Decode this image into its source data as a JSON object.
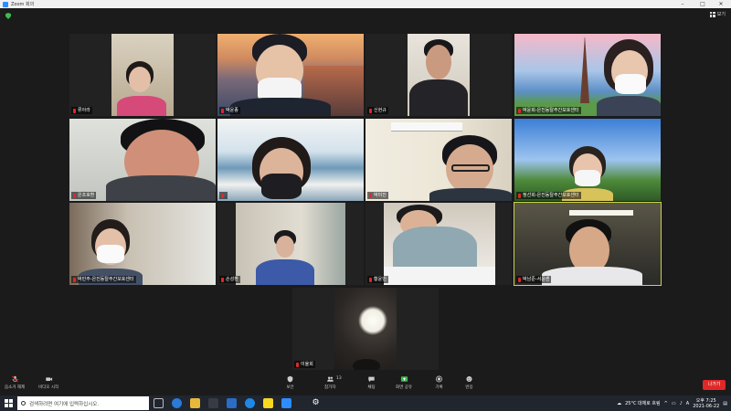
{
  "window": {
    "title": "Zoom 회의",
    "minimize": "–",
    "maximize": "□",
    "close": "✕"
  },
  "header": {
    "view_label": "보기"
  },
  "participants": [
    {
      "name": "류아라"
    },
    {
      "name": "박윤종"
    },
    {
      "name": "신현규"
    },
    {
      "name": "박윤희-은진동탈주간보호센터"
    },
    {
      "name": "은조호환"
    },
    {
      "name": ""
    },
    {
      "name": "박미진"
    },
    {
      "name": "정선희-은진동탈주간보호센터"
    },
    {
      "name": "박민주-은진동탈주간보호센터"
    },
    {
      "name": "손성환"
    },
    {
      "name": "황윤빈"
    },
    {
      "name": "박남준-서윤센"
    },
    {
      "name": "이율희"
    }
  ],
  "toolbar": {
    "audio": "음소거 해제",
    "video": "비디오 시작",
    "security": "보안",
    "participants": "참가자",
    "participants_count": "13",
    "chat": "채팅",
    "share": "화면 공유",
    "record": "기록",
    "reactions": "반응",
    "leave": "나가기"
  },
  "taskbar": {
    "search_placeholder": "검색하려면 여기에 입력하십시오.",
    "weather": "25°C 대체로 흐림",
    "time": "오후 7:25",
    "date": "2021-06-22"
  },
  "colors": {
    "accent": "#2d8cff",
    "leave": "#e02828",
    "active_speaker": "#c9d44a",
    "share": "#3fb950"
  }
}
